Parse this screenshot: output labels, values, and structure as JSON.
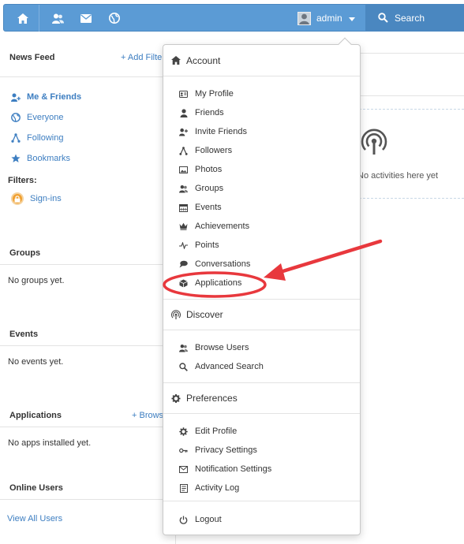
{
  "topbar": {
    "icons": [
      "home-icon",
      "friends-icon",
      "mail-icon",
      "globe-icon"
    ],
    "username": "admin",
    "search_label": "Search"
  },
  "sidebar": {
    "news_feed": {
      "title": "News Feed",
      "add_link": "+ Add Filter",
      "items": [
        {
          "label": "Me & Friends",
          "icon": "users-icon",
          "active": true
        },
        {
          "label": "Everyone",
          "icon": "globe-icon"
        },
        {
          "label": "Following",
          "icon": "following-icon"
        },
        {
          "label": "Bookmarks",
          "icon": "star-icon"
        }
      ],
      "filters_label": "Filters:",
      "filters": [
        {
          "label": "Sign-ins",
          "icon": "lock-icon"
        }
      ]
    },
    "groups": {
      "title": "Groups",
      "empty": "No groups yet."
    },
    "events": {
      "title": "Events",
      "empty": "No events yet."
    },
    "applications": {
      "title": "Applications",
      "browse_link": "+ Browse",
      "empty": "No apps installed yet."
    },
    "online_users": {
      "title": "Online Users",
      "view_all": "View All Users"
    }
  },
  "main": {
    "activity_empty": "No activities here yet"
  },
  "dropdown": {
    "account": {
      "title": "Account",
      "items": [
        {
          "label": "My Profile",
          "icon": "id-card-icon"
        },
        {
          "label": "Friends",
          "icon": "person-icon"
        },
        {
          "label": "Invite Friends",
          "icon": "add-person-icon"
        },
        {
          "label": "Followers",
          "icon": "followers-icon"
        },
        {
          "label": "Photos",
          "icon": "photo-icon"
        },
        {
          "label": "Groups",
          "icon": "group-icon"
        },
        {
          "label": "Events",
          "icon": "calendar-icon"
        },
        {
          "label": "Achievements",
          "icon": "crown-icon"
        },
        {
          "label": "Points",
          "icon": "pulse-icon"
        },
        {
          "label": "Conversations",
          "icon": "chat-icon"
        },
        {
          "label": "Applications",
          "icon": "cube-icon"
        }
      ]
    },
    "discover": {
      "title": "Discover",
      "items": [
        {
          "label": "Browse Users",
          "icon": "users-icon"
        },
        {
          "label": "Advanced Search",
          "icon": "search-icon"
        }
      ]
    },
    "preferences": {
      "title": "Preferences",
      "items": [
        {
          "label": "Edit Profile",
          "icon": "gear-icon"
        },
        {
          "label": "Privacy Settings",
          "icon": "key-icon"
        },
        {
          "label": "Notification Settings",
          "icon": "envelope-icon"
        },
        {
          "label": "Activity Log",
          "icon": "log-icon"
        }
      ]
    },
    "logout": {
      "label": "Logout",
      "icon": "power-icon"
    }
  },
  "colors": {
    "topbar": "#5b9bd5",
    "search": "#4a87c0",
    "link": "#3d7ec1",
    "annotation": "#e8383d"
  }
}
